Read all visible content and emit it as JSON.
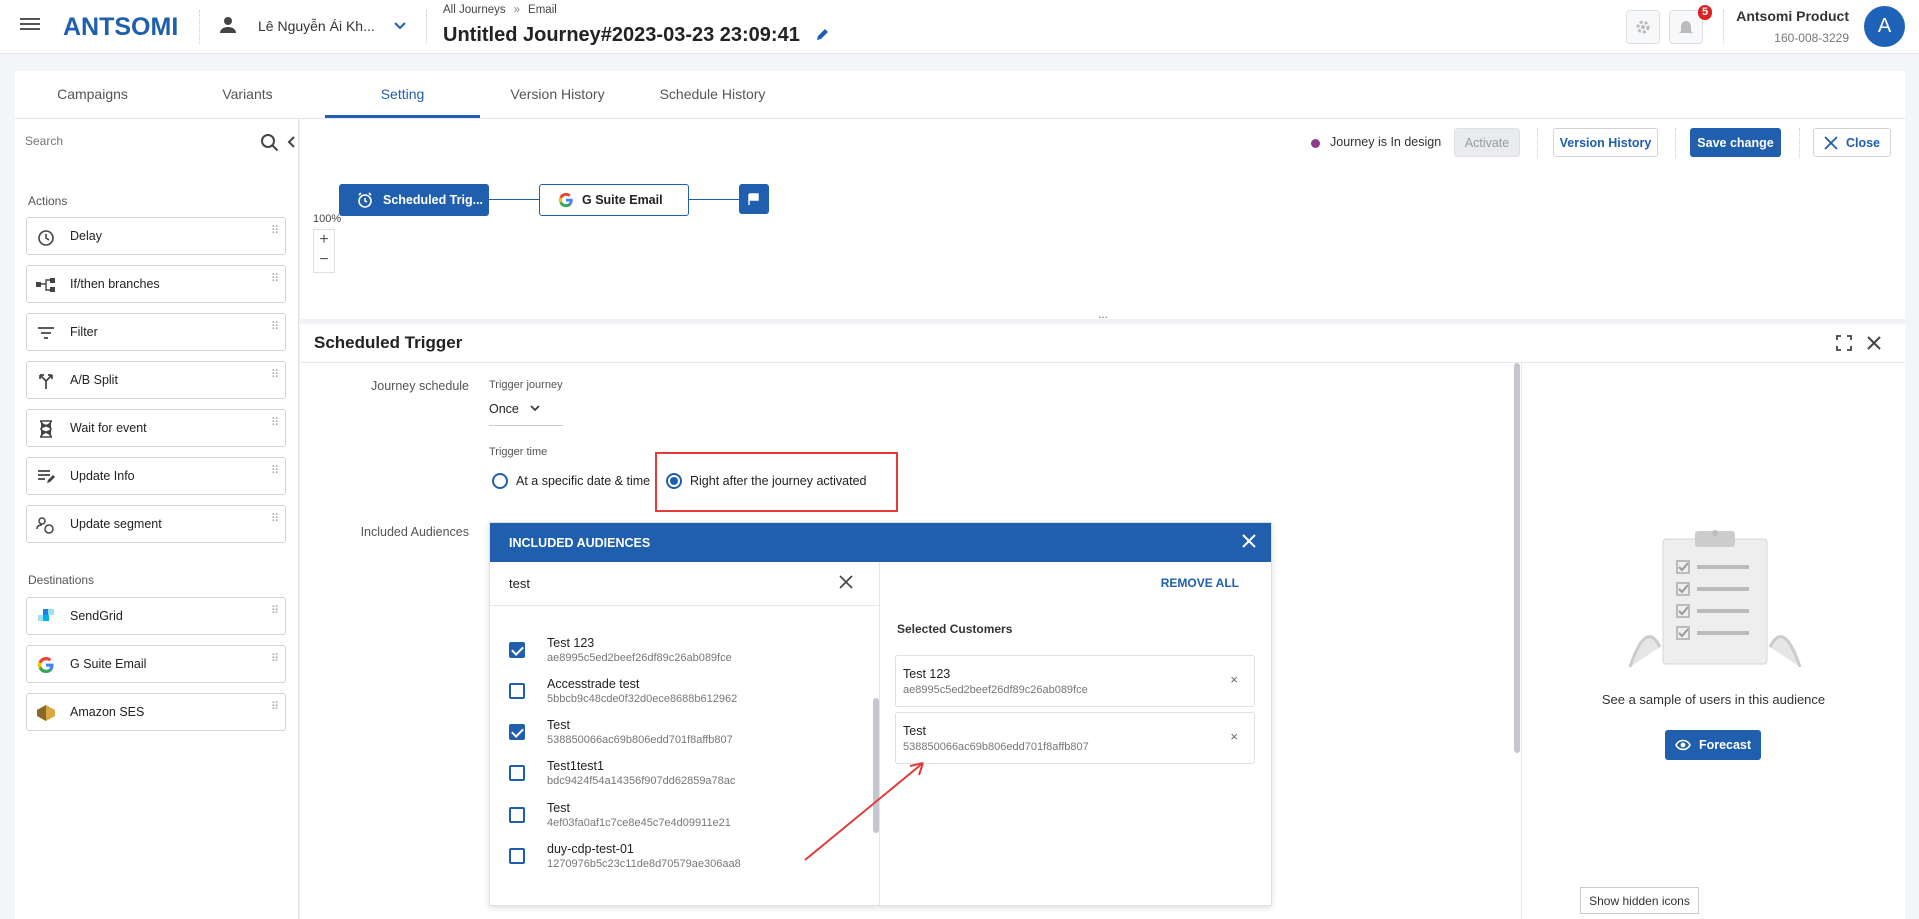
{
  "header": {
    "logo": "ANTSOMI",
    "user_name": "Lê Nguyễn Ái Kh...",
    "breadcrumb": [
      "All Journeys",
      "Email"
    ],
    "breadcrumb_sep": "»",
    "journey_title": "Untitled Journey#2023-03-23 23:09:41",
    "notification_count": "5",
    "account_name": "Antsomi Product",
    "account_id": "160-008-3229",
    "avatar_letter": "A"
  },
  "tabs": [
    {
      "label": "Campaigns",
      "active": false
    },
    {
      "label": "Variants",
      "active": false
    },
    {
      "label": "Setting",
      "active": true
    },
    {
      "label": "Version History",
      "active": false
    },
    {
      "label": "Schedule History",
      "active": false
    }
  ],
  "sidebar": {
    "search_placeholder": "Search",
    "actions_heading": "Actions",
    "actions": [
      {
        "label": "Delay",
        "icon": "delay-icon"
      },
      {
        "label": "If/then branches",
        "icon": "branch-icon"
      },
      {
        "label": "Filter",
        "icon": "filter-icon"
      },
      {
        "label": "A/B Split",
        "icon": "split-icon"
      },
      {
        "label": "Wait for event",
        "icon": "hourglass-icon"
      },
      {
        "label": "Update Info",
        "icon": "edit-list-icon"
      },
      {
        "label": "Update segment",
        "icon": "segment-icon"
      }
    ],
    "destinations_heading": "Destinations",
    "destinations": [
      {
        "label": "SendGrid",
        "icon": "sendgrid-icon"
      },
      {
        "label": "G Suite Email",
        "icon": "google-icon"
      },
      {
        "label": "Amazon SES",
        "icon": "amazon-ses-icon"
      }
    ]
  },
  "toolbar": {
    "status": "Journey is In design",
    "activate": "Activate",
    "version_history": "Version History",
    "save_change": "Save change",
    "close": "Close"
  },
  "canvas": {
    "node1": "Scheduled Trig...",
    "node2": "G Suite Email",
    "zoom": "100%",
    "zoom_in": "+",
    "zoom_out": "−",
    "resize_handle": "..."
  },
  "detail": {
    "title": "Scheduled Trigger",
    "journey_schedule_label": "Journey schedule",
    "trigger_journey_label": "Trigger journey",
    "trigger_journey_value": "Once",
    "trigger_time_label": "Trigger time",
    "option_specific": "At a specific date & time",
    "option_right_after": "Right after the journey activated",
    "included_audiences_label": "Included Audiences"
  },
  "audiences": {
    "header": "INCLUDED AUDIENCES",
    "search_value": "test",
    "remove_all": "REMOVE ALL",
    "selected_heading": "Selected Customers",
    "items": [
      {
        "name": "Test 123",
        "id": "ae8995c5ed2beef26df89c26ab089fce",
        "checked": true
      },
      {
        "name": "Accesstrade test",
        "id": "5bbcb9c48cde0f32d0ece8688b612962",
        "checked": false
      },
      {
        "name": "Test",
        "id": "538850066ac69b806edd701f8affb807",
        "checked": true
      },
      {
        "name": "Test1test1",
        "id": "bdc9424f54a14356f907dd62859a78ac",
        "checked": false
      },
      {
        "name": "Test",
        "id": "4ef03fa0af1c7ce8e45c7e4d09911e21",
        "checked": false
      },
      {
        "name": "duy-cdp-test-01",
        "id": "1270976b5c23c11de8d70579ae306aa8",
        "checked": false
      }
    ],
    "selected": [
      {
        "name": "Test 123",
        "id": "ae8995c5ed2beef26df89c26ab089fce"
      },
      {
        "name": "Test",
        "id": "538850066ac69b806edd701f8affb807"
      }
    ]
  },
  "sample": {
    "text": "See a sample of users in this audience",
    "forecast": "Forecast"
  },
  "tooltip": "Show hidden icons",
  "colors": {
    "primary": "#1f5fae",
    "annotation": "#e23b3b",
    "status_dot": "#8b3d8b"
  }
}
